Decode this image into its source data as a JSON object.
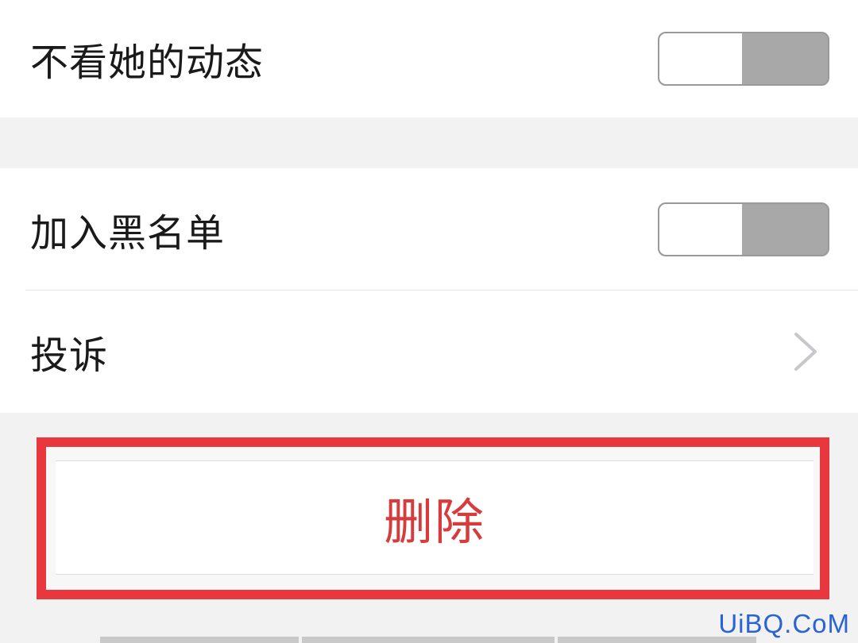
{
  "settings": {
    "hide_moments": {
      "label": "不看她的动态",
      "enabled": false
    },
    "blacklist": {
      "label": "加入黑名单",
      "enabled": false
    },
    "complaint": {
      "label": "投诉"
    },
    "delete": {
      "label": "删除",
      "color": "#d83b3b"
    }
  },
  "highlight": {
    "color": "#e8383d"
  },
  "watermark": "UiBQ.CoM"
}
